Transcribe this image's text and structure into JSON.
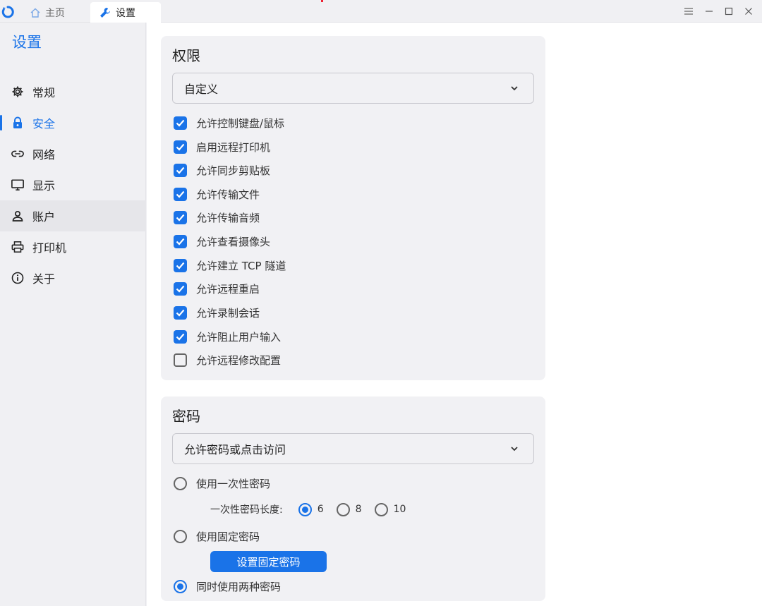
{
  "titlebar": {
    "tabs": [
      {
        "label": "主页",
        "icon": "home-icon"
      },
      {
        "label": "设置",
        "icon": "wrench-icon"
      }
    ]
  },
  "sidebar": {
    "title": "设置",
    "items": [
      {
        "label": "常规",
        "icon": "gear-icon"
      },
      {
        "label": "安全",
        "icon": "lock-icon"
      },
      {
        "label": "网络",
        "icon": "link-icon"
      },
      {
        "label": "显示",
        "icon": "monitor-icon"
      },
      {
        "label": "账户",
        "icon": "user-icon"
      },
      {
        "label": "打印机",
        "icon": "printer-icon"
      },
      {
        "label": "关于",
        "icon": "info-icon"
      }
    ],
    "active": "安全"
  },
  "permissions": {
    "title": "权限",
    "mode": "自定义",
    "options": [
      {
        "label": "允许控制键盘/鼠标",
        "checked": true
      },
      {
        "label": "启用远程打印机",
        "checked": true
      },
      {
        "label": "允许同步剪贴板",
        "checked": true
      },
      {
        "label": "允许传输文件",
        "checked": true
      },
      {
        "label": "允许传输音频",
        "checked": true
      },
      {
        "label": "允许查看摄像头",
        "checked": true
      },
      {
        "label": "允许建立 TCP 隧道",
        "checked": true
      },
      {
        "label": "允许远程重启",
        "checked": true
      },
      {
        "label": "允许录制会话",
        "checked": true
      },
      {
        "label": "允许阻止用户输入",
        "checked": true
      },
      {
        "label": "允许远程修改配置",
        "checked": false
      }
    ]
  },
  "password": {
    "title": "密码",
    "mode": "允许密码或点击访问",
    "one_time_label": "使用一次性密码",
    "length_label": "一次性密码长度:",
    "lengths": [
      "6",
      "8",
      "10"
    ],
    "selected_length": "6",
    "fixed_label": "使用固定密码",
    "set_fixed_button": "设置固定密码",
    "both_label": "同时使用两种密码",
    "selected_mode": "同时使用两种密码"
  },
  "colors": {
    "accent": "#1a73e8",
    "card": "#f1f1f4",
    "sidebar": "#f0f0f3"
  }
}
